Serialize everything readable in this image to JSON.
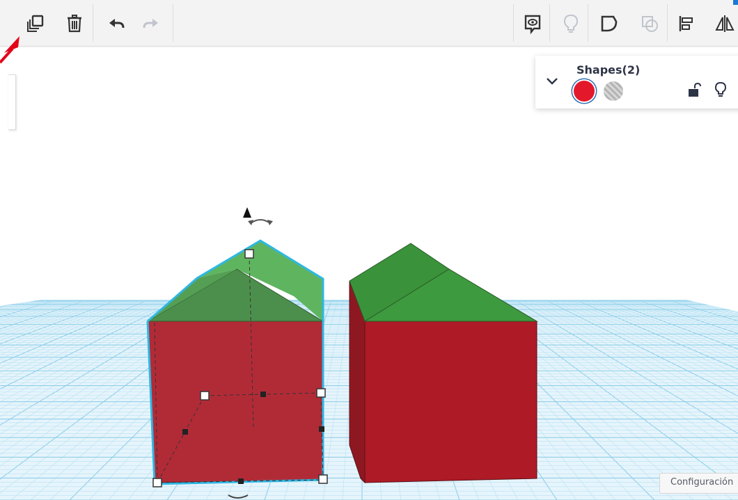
{
  "colors": {
    "toolbar_bg": "#f3f3f3",
    "grid_bg": "#e3f3fb",
    "grid_major": "#8ecfe9",
    "grid_minor": "#b7e2f4",
    "shape_red": "#ae1c28",
    "shape_red_side": "#8c1822",
    "roof_green": "#3f9b3f",
    "roof_green_light": "#5bb25b",
    "selection_outline": "#2fb7e3",
    "annotation_arrow": "#e3061a"
  },
  "toolbar": {
    "icons": [
      "duplicate-icon",
      "delete-icon",
      "undo-icon",
      "redo-icon",
      "note-icon",
      "light-bulb-icon",
      "group-icon",
      "ungroup-icon",
      "align-icon",
      "mirror-icon"
    ]
  },
  "shapes_panel": {
    "title": "Shapes(2)",
    "swatches": [
      "solid-red",
      "hole-striped"
    ],
    "swatch_color": "#e3192b"
  },
  "settings": {
    "label": "Configuración"
  }
}
